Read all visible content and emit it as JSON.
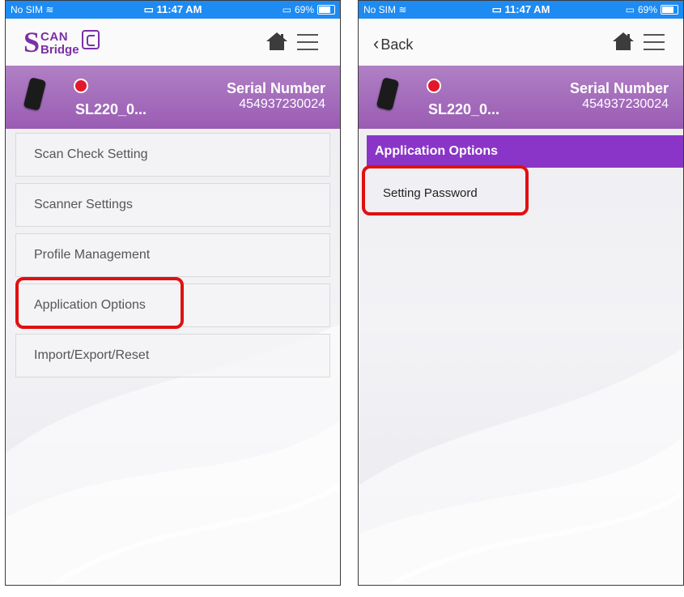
{
  "left_screen": {
    "status_bar": {
      "carrier": "No SIM",
      "time": "11:47 AM",
      "battery": "69%"
    },
    "nav": {
      "logo_s": "S",
      "logo_scan": "CAN",
      "logo_bridge": "Bridge"
    },
    "device": {
      "name": "SL220_0...",
      "serial_label": "Serial Number",
      "serial_number": "454937230024"
    },
    "menu": {
      "items": [
        {
          "label": "Scan Check Setting"
        },
        {
          "label": "Scanner Settings"
        },
        {
          "label": "Profile Management"
        },
        {
          "label": "Application Options"
        },
        {
          "label": "Import/Export/Reset"
        }
      ]
    }
  },
  "right_screen": {
    "status_bar": {
      "carrier": "No SIM",
      "time": "11:47 AM",
      "battery": "69%"
    },
    "nav": {
      "back_label": "Back"
    },
    "device": {
      "name": "SL220_0...",
      "serial_label": "Serial Number",
      "serial_number": "454937230024"
    },
    "section": {
      "title": "Application Options"
    },
    "items": [
      {
        "label": "Setting Password"
      }
    ]
  },
  "colors": {
    "status_bar": "#1d8bf2",
    "brand_purple": "#8a35c7",
    "device_bar": "#a46cbc",
    "status_dot": "#e2192b",
    "highlight": "#e20f0f"
  }
}
